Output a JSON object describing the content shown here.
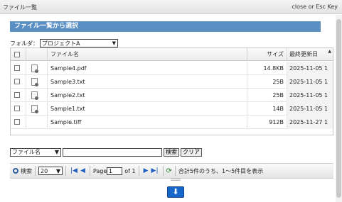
{
  "window": {
    "title": "ファイル一覧",
    "close_hint": "close or Esc Key"
  },
  "section": {
    "title": "ファイル一覧から選択"
  },
  "folder": {
    "label": "フォルダ：",
    "selected": "プロジェクトA"
  },
  "table": {
    "columns": [
      "",
      "",
      "ファイル名",
      "サイズ",
      "最終更新日"
    ],
    "rows": [
      {
        "name": "Sample4.pdf",
        "size": "14.8KB",
        "updated": "2025-11-05 1",
        "has_icon": true
      },
      {
        "name": "Sample3.txt",
        "size": "25B",
        "updated": "2025-11-05 1",
        "has_icon": true
      },
      {
        "name": "Sample2.txt",
        "size": "25B",
        "updated": "2025-11-05 1",
        "has_icon": true
      },
      {
        "name": "Sample1.txt",
        "size": "14B",
        "updated": "2025-11-05 1",
        "has_icon": true
      },
      {
        "name": "Sample.tiff",
        "size": "912B",
        "updated": "2025-11-27 1",
        "has_icon": false
      }
    ]
  },
  "search": {
    "field_selected": "ファイル名",
    "search_label": "検索",
    "clear_label": "クリア",
    "input_value": ""
  },
  "pager": {
    "search_label": "検索",
    "page_size": "20",
    "page_label": "Page",
    "page_value": "1",
    "of_label": "of 1",
    "summary": "合計5件のうち、1～5件目を表示"
  },
  "icons": {
    "sort": "sort-asc-icon",
    "download": "download-arrow-icon"
  }
}
